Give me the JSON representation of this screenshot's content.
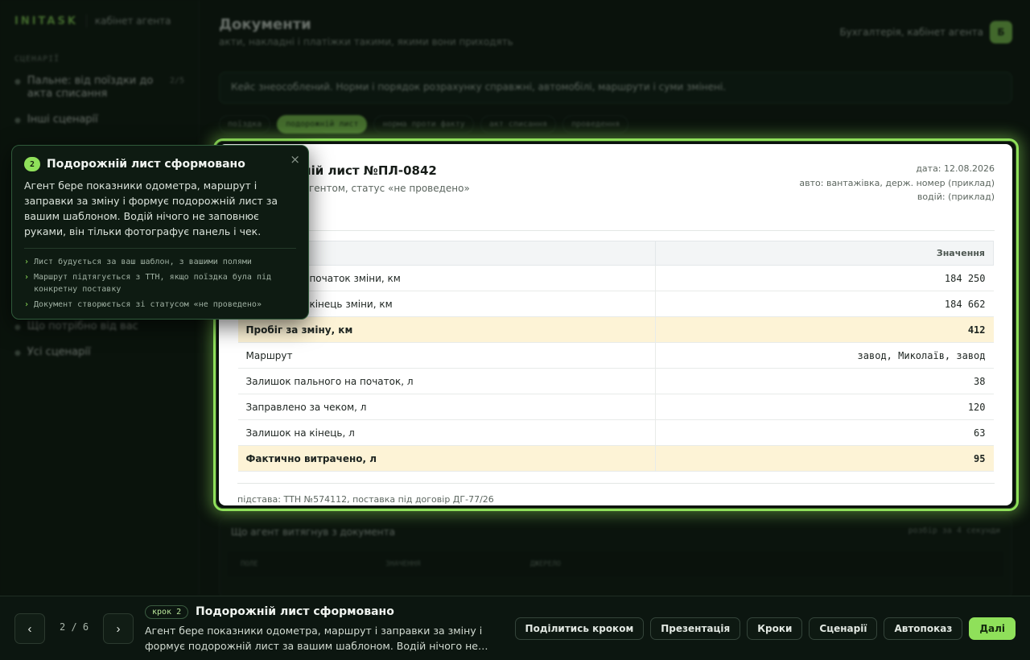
{
  "app": {
    "logo": "INITASK",
    "subtitle": "кабінет агента"
  },
  "sidebar": {
    "section_label": "СЦЕНАРІЇ",
    "items": [
      {
        "label": "Пальне: від поїздки до акта списання",
        "count": "2/5"
      },
      {
        "label": "Інші сценарії"
      }
    ],
    "lower_items": [
      {
        "label": "Що потрібно від вас"
      },
      {
        "label": "Усі сценарії"
      }
    ]
  },
  "header": {
    "title": "Документи",
    "subtitle": "акти, накладні і платіжки такими, якими вони приходять",
    "user_label": "Бухгалтерія, кабінет агента",
    "user_initial": "Б"
  },
  "notice": "Кейс знеособлений. Норми і порядок розрахунку справжні, автомобілі, маршрути і суми змінені.",
  "tabs": [
    {
      "label": "поїздка",
      "active": false
    },
    {
      "label": "подорожній лист",
      "active": true
    },
    {
      "label": "норма проти факту",
      "active": false
    },
    {
      "label": "акт списання",
      "active": false
    },
    {
      "label": "проведення",
      "active": false
    }
  ],
  "document": {
    "title": "Подорожній лист №ПЛ-0842",
    "status": "сформовано агентом, статус «не проведено»",
    "meta": [
      "дата: 12.08.2026",
      "авто: вантажівка, держ. номер (приклад)",
      "водій: (приклад)"
    ],
    "columns": {
      "key": "Показник",
      "value": "Значення"
    },
    "rows": [
      {
        "key": "Одометр на початок зміни, км",
        "value": "184 250",
        "highlight": false
      },
      {
        "key": "Одометр на кінець зміни, км",
        "value": "184 662",
        "highlight": false
      },
      {
        "key": "Пробіг за зміну, км",
        "value": "412",
        "highlight": true
      },
      {
        "key": "Маршрут",
        "value": "завод, Миколаїв, завод",
        "highlight": false
      },
      {
        "key": "Залишок пального на початок, л",
        "value": "38",
        "highlight": false
      },
      {
        "key": "Заправлено за чеком, л",
        "value": "120",
        "highlight": false
      },
      {
        "key": "Залишок на кінець, л",
        "value": "63",
        "highlight": false
      },
      {
        "key": "Фактично витрачено, л",
        "value": "95",
        "highlight": true
      }
    ],
    "footer": "підстава: ТТН №574112, поставка під договір ДГ-77/26"
  },
  "extract": {
    "title": "Що агент витягнув з документа",
    "right": "розбір за 4 секунди",
    "columns": [
      "ПОЛЕ",
      "ЗНАЧЕННЯ",
      "ДЖЕРЕЛО"
    ]
  },
  "popover": {
    "number": "2",
    "title": "Подорожній лист сформовано",
    "close": "×",
    "description": "Агент бере показники одометра, маршрут і заправки за зміну і формує подорожній лист за вашим шаблоном. Водій нічого не заповнює руками, він тільки фотографує панель і чек.",
    "bullets": [
      "Лист будується за ваш шаблон, з вашими полями",
      "Маршрут підтягується з ТТН, якщо поїздка була під конкретну поставку",
      "Документ створюється зі статусом «не проведено»"
    ]
  },
  "bottom_bar": {
    "prev": "‹",
    "next": "›",
    "counter": "2 / 6",
    "step_badge": "крок 2",
    "step_title": "Подорожній лист сформовано",
    "step_desc": "Агент бере показники одометра, маршрут і заправки за зміну і формує подорожній лист за вашим шаблоном. Водій нічого не…",
    "actions": {
      "share": "Поділитись кроком",
      "presentation": "Презентація",
      "steps": "Кроки",
      "scenarios": "Сценарії",
      "autoplay": "Автопоказ",
      "next": "Далі"
    }
  },
  "colors": {
    "accent": "#8fe05a",
    "highlight_row": "#fdf3d6"
  }
}
